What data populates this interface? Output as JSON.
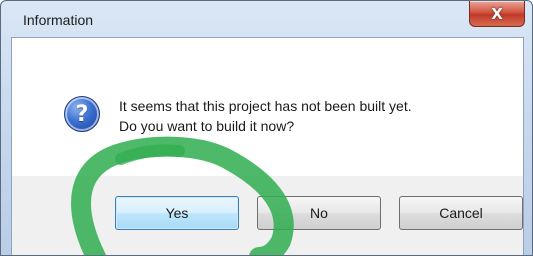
{
  "window": {
    "title": "Information",
    "close_glyph": "X"
  },
  "dialog": {
    "icon": "question-icon",
    "icon_glyph": "?",
    "message_line1": "It seems that this project has not been built yet.",
    "message_line2": "Do you want to build it now?"
  },
  "buttons": {
    "yes": "Yes",
    "no": "No",
    "cancel": "Cancel"
  },
  "annotation": {
    "color": "#2fae4f",
    "shape": "hand-drawn-circle-around-yes-button"
  }
}
